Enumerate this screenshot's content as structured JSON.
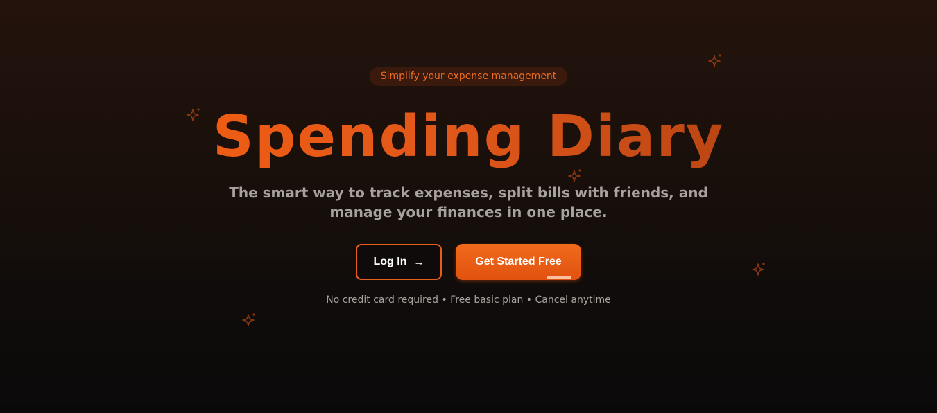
{
  "hero": {
    "badge": "Simplify your expense management",
    "title": "Spending Diary",
    "subtitle": "The smart way to track expenses, split bills with friends, and manage your finances in one place.",
    "login_label": "Log In",
    "login_icon": "→",
    "start_label": "Get Started Free",
    "note": "No credit card required • Free basic plan • Cancel anytime"
  },
  "colors": {
    "accent": "#ea5c19",
    "sparkle": "#8a3810",
    "muted_text": "#a8a29e"
  },
  "icons": [
    "sparkle-icon",
    "arrow-right-icon"
  ]
}
